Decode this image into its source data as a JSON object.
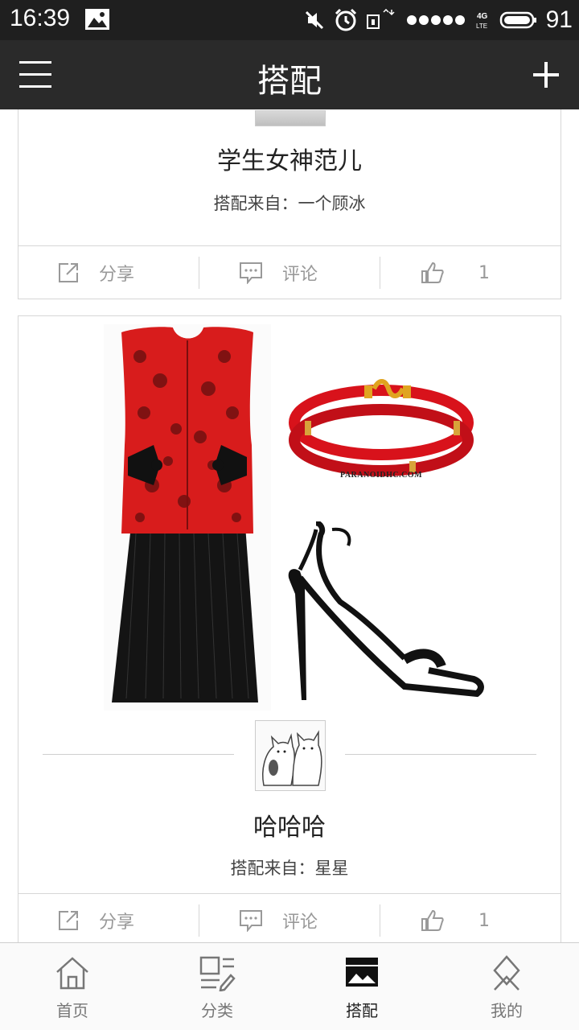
{
  "status_bar": {
    "time": "16:39",
    "battery": "91",
    "network": "4G LTE"
  },
  "header": {
    "title": "搭配"
  },
  "cards": [
    {
      "title": "学生女神范儿",
      "from_label": "搭配来自：一个顾冰",
      "actions": {
        "share": "分享",
        "comment": "评论",
        "likes": "1"
      }
    },
    {
      "title": "哈哈哈",
      "from_label": "搭配来自：星星",
      "brand_text": "PARANOIDHC.COM",
      "actions": {
        "share": "分享",
        "comment": "评论",
        "likes": "1"
      }
    }
  ],
  "bottom_nav": [
    {
      "label": "首页",
      "icon": "home-icon"
    },
    {
      "label": "分类",
      "icon": "category-icon"
    },
    {
      "label": "搭配",
      "icon": "outfit-icon",
      "active": true
    },
    {
      "label": "我的",
      "icon": "profile-icon"
    }
  ],
  "colors": {
    "status_bar": "#1f1f1f",
    "top_bar": "#2a2a2a",
    "dress_red": "#d81c1c"
  }
}
